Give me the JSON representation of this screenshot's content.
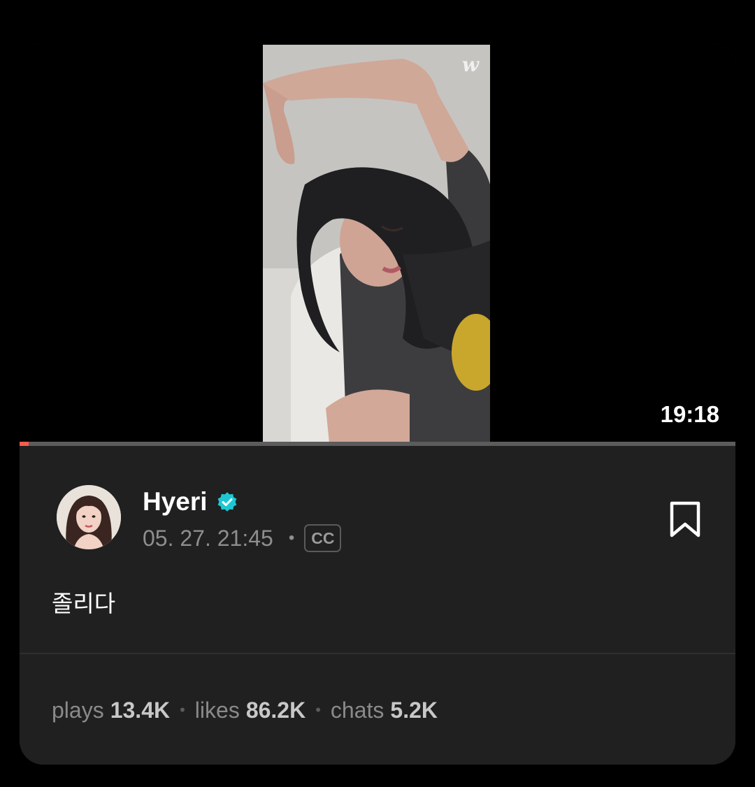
{
  "video": {
    "duration": "19:18",
    "progress_fraction": 0.013,
    "watermark": "w"
  },
  "post": {
    "author": "Hyeri",
    "verified": true,
    "date": "05. 27. 21:45",
    "separator": "•",
    "cc_badge": "CC",
    "caption": "졸리다"
  },
  "stats": [
    {
      "label": "plays",
      "value": "13.4K"
    },
    {
      "label": "likes",
      "value": "86.2K"
    },
    {
      "label": "chats",
      "value": "5.2K"
    }
  ],
  "stat_separator": "•",
  "icons": {
    "verified": "verified-badge-icon",
    "bookmark": "bookmark-icon"
  },
  "colors": {
    "progress": "#ff5a4f",
    "verified": "#1ec8d2",
    "card_bg": "#202020"
  }
}
